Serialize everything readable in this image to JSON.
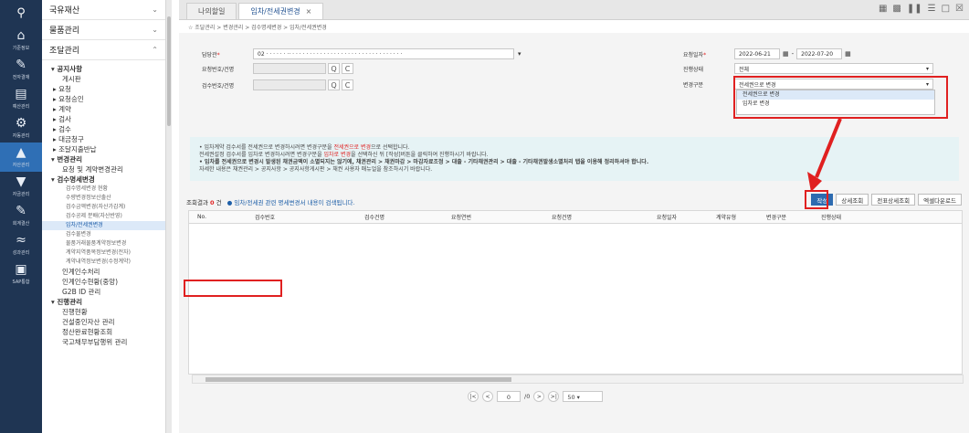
{
  "rail": {
    "top_icon": "search-icon",
    "items": [
      {
        "label": "기준정보",
        "icon": "home-icon"
      },
      {
        "label": "전자결재",
        "icon": "approval-icon"
      },
      {
        "label": "예산관리",
        "icon": "budget-icon"
      },
      {
        "label": "자동관리",
        "icon": "auto-icon"
      },
      {
        "label": "자산관리",
        "icon": "asset-icon"
      },
      {
        "label": "자금관리",
        "icon": "fund-icon"
      },
      {
        "label": "회계결산",
        "icon": "accounting-icon"
      },
      {
        "label": "성과관리",
        "icon": "chart-icon"
      },
      {
        "label": "SAP통합",
        "icon": "sap-icon"
      }
    ]
  },
  "menu": {
    "sections": [
      "국유재산",
      "물품관리",
      "조달관리"
    ],
    "items": [
      {
        "label": "공지사항",
        "level": "l1"
      },
      {
        "label": "게시판",
        "level": "l2"
      },
      {
        "label": "요청",
        "level": "l1b"
      },
      {
        "label": "요청승인",
        "level": "l1b"
      },
      {
        "label": "계약",
        "level": "l1b"
      },
      {
        "label": "검사",
        "level": "l1b"
      },
      {
        "label": "검수",
        "level": "l1b"
      },
      {
        "label": "대금청구",
        "level": "l1b"
      },
      {
        "label": "조달지출반납",
        "level": "l1b"
      },
      {
        "label": "변경관리",
        "level": "l1"
      },
      {
        "label": "요청 및 계약변경관리",
        "level": "l2"
      },
      {
        "label": "검수명세변경",
        "level": "l1"
      },
      {
        "label": "검수명세변경 현황",
        "level": "l3"
      },
      {
        "label": "수량변경정보산출산",
        "level": "l3"
      },
      {
        "label": "검수금액변경(자산가감계)",
        "level": "l3"
      },
      {
        "label": "검수공제 분배(자산반영)",
        "level": "l3"
      },
      {
        "label": "임차/전세권변경",
        "level": "sel"
      },
      {
        "label": "검수물변경",
        "level": "l3"
      },
      {
        "label": "물품거래물품계약정보변경",
        "level": "l3"
      },
      {
        "label": "계약지역품목정보변경(전자)",
        "level": "l3"
      },
      {
        "label": "계약내역정보변경(수정계약)",
        "level": "l3"
      },
      {
        "label": "인계인수처리",
        "level": "l2"
      },
      {
        "label": "인계인수현황(중앙)",
        "level": "l2"
      },
      {
        "label": "G2B ID 관리",
        "level": "l2"
      },
      {
        "label": "진행관리",
        "level": "l1"
      },
      {
        "label": "진행현황",
        "level": "l2"
      },
      {
        "label": "건설중인자산 관리",
        "level": "l2"
      },
      {
        "label": "정산완료현황조회",
        "level": "l2"
      },
      {
        "label": "국고채무부담행위 관리",
        "level": "l2"
      }
    ]
  },
  "tabs": [
    {
      "label": "나의할일",
      "active": false
    },
    {
      "label": "임차/전세권변경",
      "active": true
    }
  ],
  "breadcrumb": "☆ 조달관리 > 변경관리 > 검수명세변경 > 임차/전세권변경",
  "form": {
    "owner_label": "담당관",
    "owner_value": "02 · · · · · · ·· · · · · · · · · · · · · · · · · · · · · · · · · · · · · · · · ·",
    "request_label": "요청번호/건명",
    "inspect_label": "검수번호/건명",
    "date_label": "요청일자",
    "date_from": "2022-06-21",
    "date_to": "2022-07-20",
    "status_label": "진행상태",
    "status_value": "전체",
    "change_type_label": "변경구분",
    "change_type_value": "전세권으로 변경",
    "change_options": [
      "전세권으로 변경",
      "임차로 변경"
    ]
  },
  "info": {
    "line1a": "• 임차계약 검수서를 전세권으로 변경하시려면 변경구분을 ",
    "line1b": "전세권으로 변경",
    "line1c": "으로 선택합니다.",
    "line2a": "  전세권설정 검수서를 임차로 변경하시려면 변경구분을 ",
    "line2b": "임차로 변경",
    "line2c": "을 선택하신 뒤 [작성]버튼을 클릭하여 진행하시기 바랍니다.",
    "line3": "• 임차를 전세권으로 변경시 발생된 채권금액이 소멸되지는 않기에, 채권관리 > 채권마감 > 마감자료조정 > 대출 - 기타채권관리 > 대출 - 기타채권발생소멸처리 탭을 이용해 정리하셔야 합니다.",
    "line4": "  자세한 내용은 채권관리 > 공지사항 > 공지사항게시판 > 채권 사용자 매뉴얼을 참조하시기 바랍니다."
  },
  "grid": {
    "count_label": "조회결과",
    "count": "0",
    "count_unit": "건",
    "message": "임차/전세권 관련 명세변경서 내용이 검색됩니다.",
    "buttons": [
      "작성",
      "상세조회",
      "전표상세조회",
      "엑셀다운로드"
    ],
    "columns": [
      "No.",
      "검수번호",
      "검수건명",
      "요청연번",
      "요청건명",
      "요청일자",
      "계약유형",
      "변경구분",
      "진행상태"
    ]
  },
  "pager": {
    "page": "0",
    "total": "/0",
    "page_size": "50"
  },
  "colors": {
    "rail": "#1f3553",
    "accent": "#2d6bb0",
    "highlight": "#e02020",
    "info_bg": "#e6f3f5"
  }
}
